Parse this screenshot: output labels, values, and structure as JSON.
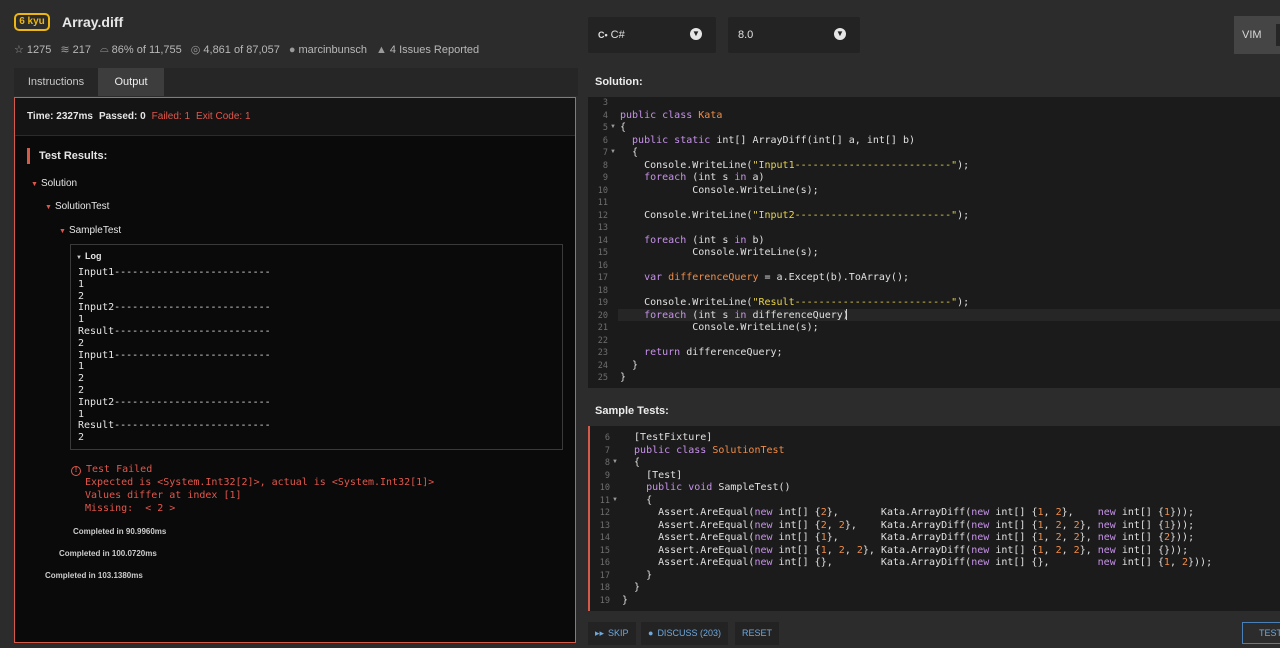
{
  "header": {
    "rank": "6 kyu",
    "title": "Array.diff",
    "stats": {
      "stars": "1275",
      "collections": "217",
      "satisfaction": "86% of 11,755",
      "completed": "4,861 of 87,057",
      "author": "marcinbunsch",
      "issues": "4 Issues Reported"
    }
  },
  "language": {
    "selected": "C#",
    "version": "8.0"
  },
  "vim_label": "VIM",
  "tabs": [
    {
      "label": "Instructions",
      "active": false
    },
    {
      "label": "Output",
      "active": true
    }
  ],
  "output": {
    "time": "Time: 2327ms",
    "passed": "Passed: 0",
    "failed": "Failed: 1",
    "exit_code": "Exit Code: 1",
    "results_header": "Test Results:",
    "tree": [
      "Solution",
      "SolutionTest",
      "SampleTest"
    ],
    "log_label": "Log",
    "log_lines": [
      "Input1--------------------------",
      "1",
      "2",
      "Input2--------------------------",
      "1",
      "Result--------------------------",
      "2",
      "Input1--------------------------",
      "1",
      "2",
      "2",
      "Input2--------------------------",
      "1",
      "Result--------------------------",
      "2"
    ],
    "fail_title": "Test Failed",
    "fail_lines": [
      "Expected is <System.Int32[2]>, actual is <System.Int32[1]>",
      "Values differ at index [1]",
      "Missing:  < 2 >"
    ],
    "completed": [
      "Completed in 90.9960ms",
      "Completed in 100.0720ms",
      "Completed in 103.1380ms"
    ]
  },
  "solution": {
    "header": "Solution:",
    "line_numbers": [
      "3",
      "4",
      "5",
      "6",
      "7",
      "8",
      "9",
      "10",
      "11",
      "12",
      "13",
      "14",
      "15",
      "16",
      "17",
      "18",
      "19",
      "20",
      "21",
      "22",
      "23",
      "24",
      "25"
    ],
    "lines": [
      [],
      [
        {
          "t": "public class ",
          "c": "kw"
        },
        {
          "t": "Kata",
          "c": "cls"
        }
      ],
      [
        {
          "t": "{",
          "c": ""
        }
      ],
      [
        {
          "t": "  public static ",
          "c": "kw"
        },
        {
          "t": "int[] ArrayDiff(int[] a, int[] b)",
          "c": ""
        }
      ],
      [
        {
          "t": "  {",
          "c": ""
        }
      ],
      [
        {
          "t": "    Console.WriteLine(",
          "c": ""
        },
        {
          "t": "\"Input1--------------------------\"",
          "c": "str"
        },
        {
          "t": ");",
          "c": ""
        }
      ],
      [
        {
          "t": "    foreach ",
          "c": "kw"
        },
        {
          "t": "(int s ",
          "c": ""
        },
        {
          "t": "in ",
          "c": "kw"
        },
        {
          "t": "a)",
          "c": ""
        }
      ],
      [
        {
          "t": "            Console.WriteLine(s);",
          "c": ""
        }
      ],
      [],
      [
        {
          "t": "    Console.WriteLine(",
          "c": ""
        },
        {
          "t": "\"Input2--------------------------\"",
          "c": "str"
        },
        {
          "t": ");",
          "c": ""
        }
      ],
      [],
      [
        {
          "t": "    foreach ",
          "c": "kw"
        },
        {
          "t": "(int s ",
          "c": ""
        },
        {
          "t": "in ",
          "c": "kw"
        },
        {
          "t": "b)",
          "c": ""
        }
      ],
      [
        {
          "t": "            Console.WriteLine(s);",
          "c": ""
        }
      ],
      [],
      [
        {
          "t": "    var ",
          "c": "kw"
        },
        {
          "t": "differenceQuery",
          "c": "var"
        },
        {
          "t": " = a.Except(b).ToArray();",
          "c": ""
        }
      ],
      [],
      [
        {
          "t": "    Console.WriteLine(",
          "c": ""
        },
        {
          "t": "\"Result--------------------------\"",
          "c": "str"
        },
        {
          "t": ");",
          "c": ""
        }
      ],
      [
        {
          "t": "    foreach ",
          "c": "kw"
        },
        {
          "t": "(int s ",
          "c": ""
        },
        {
          "t": "in ",
          "c": "kw"
        },
        {
          "t": "differenceQuery)",
          "c": ""
        }
      ],
      [
        {
          "t": "            Console.WriteLine(s);",
          "c": ""
        }
      ],
      [],
      [
        {
          "t": "    return ",
          "c": "kw"
        },
        {
          "t": "differenceQuery;",
          "c": ""
        }
      ],
      [
        {
          "t": "  }",
          "c": ""
        }
      ],
      [
        {
          "t": "}",
          "c": ""
        }
      ]
    ]
  },
  "sample_tests": {
    "header": "Sample Tests:",
    "line_numbers": [
      "6",
      "7",
      "8",
      "9",
      "10",
      "11",
      "12",
      "13",
      "14",
      "15",
      "16",
      "17",
      "18",
      "19"
    ],
    "lines": [
      [
        {
          "t": "  [TestFixture]",
          "c": ""
        }
      ],
      [
        {
          "t": "  public class ",
          "c": "kw"
        },
        {
          "t": "SolutionTest",
          "c": "cls"
        }
      ],
      [
        {
          "t": "  {",
          "c": ""
        }
      ],
      [
        {
          "t": "    [Test]",
          "c": ""
        }
      ],
      [
        {
          "t": "    public void ",
          "c": "kw"
        },
        {
          "t": "SampleTest()",
          "c": ""
        }
      ],
      [
        {
          "t": "    {",
          "c": ""
        }
      ],
      [
        {
          "t": "      Assert.AreEqual(",
          "c": ""
        },
        {
          "t": "new ",
          "c": "kw"
        },
        {
          "t": "int[] {",
          "c": ""
        },
        {
          "t": "2",
          "c": "num"
        },
        {
          "t": "},       Kata.ArrayDiff(",
          "c": ""
        },
        {
          "t": "new ",
          "c": "kw"
        },
        {
          "t": "int[] {",
          "c": ""
        },
        {
          "t": "1",
          "c": "num"
        },
        {
          "t": ", ",
          "c": ""
        },
        {
          "t": "2",
          "c": "num"
        },
        {
          "t": "},    ",
          "c": ""
        },
        {
          "t": "new ",
          "c": "kw"
        },
        {
          "t": "int[] {",
          "c": ""
        },
        {
          "t": "1",
          "c": "num"
        },
        {
          "t": "}));",
          "c": ""
        }
      ],
      [
        {
          "t": "      Assert.AreEqual(",
          "c": ""
        },
        {
          "t": "new ",
          "c": "kw"
        },
        {
          "t": "int[] {",
          "c": ""
        },
        {
          "t": "2",
          "c": "num"
        },
        {
          "t": ", ",
          "c": ""
        },
        {
          "t": "2",
          "c": "num"
        },
        {
          "t": "},    Kata.ArrayDiff(",
          "c": ""
        },
        {
          "t": "new ",
          "c": "kw"
        },
        {
          "t": "int[] {",
          "c": ""
        },
        {
          "t": "1",
          "c": "num"
        },
        {
          "t": ", ",
          "c": ""
        },
        {
          "t": "2",
          "c": "num"
        },
        {
          "t": ", ",
          "c": ""
        },
        {
          "t": "2",
          "c": "num"
        },
        {
          "t": "}, ",
          "c": ""
        },
        {
          "t": "new ",
          "c": "kw"
        },
        {
          "t": "int[] {",
          "c": ""
        },
        {
          "t": "1",
          "c": "num"
        },
        {
          "t": "}));",
          "c": ""
        }
      ],
      [
        {
          "t": "      Assert.AreEqual(",
          "c": ""
        },
        {
          "t": "new ",
          "c": "kw"
        },
        {
          "t": "int[] {",
          "c": ""
        },
        {
          "t": "1",
          "c": "num"
        },
        {
          "t": "},       Kata.ArrayDiff(",
          "c": ""
        },
        {
          "t": "new ",
          "c": "kw"
        },
        {
          "t": "int[] {",
          "c": ""
        },
        {
          "t": "1",
          "c": "num"
        },
        {
          "t": ", ",
          "c": ""
        },
        {
          "t": "2",
          "c": "num"
        },
        {
          "t": ", ",
          "c": ""
        },
        {
          "t": "2",
          "c": "num"
        },
        {
          "t": "}, ",
          "c": ""
        },
        {
          "t": "new ",
          "c": "kw"
        },
        {
          "t": "int[] {",
          "c": ""
        },
        {
          "t": "2",
          "c": "num"
        },
        {
          "t": "}));",
          "c": ""
        }
      ],
      [
        {
          "t": "      Assert.AreEqual(",
          "c": ""
        },
        {
          "t": "new ",
          "c": "kw"
        },
        {
          "t": "int[] {",
          "c": ""
        },
        {
          "t": "1",
          "c": "num"
        },
        {
          "t": ", ",
          "c": ""
        },
        {
          "t": "2",
          "c": "num"
        },
        {
          "t": ", ",
          "c": ""
        },
        {
          "t": "2",
          "c": "num"
        },
        {
          "t": "}, Kata.ArrayDiff(",
          "c": ""
        },
        {
          "t": "new ",
          "c": "kw"
        },
        {
          "t": "int[] {",
          "c": ""
        },
        {
          "t": "1",
          "c": "num"
        },
        {
          "t": ", ",
          "c": ""
        },
        {
          "t": "2",
          "c": "num"
        },
        {
          "t": ", ",
          "c": ""
        },
        {
          "t": "2",
          "c": "num"
        },
        {
          "t": "}, ",
          "c": ""
        },
        {
          "t": "new ",
          "c": "kw"
        },
        {
          "t": "int[] {}));",
          "c": ""
        }
      ],
      [
        {
          "t": "      Assert.AreEqual(",
          "c": ""
        },
        {
          "t": "new ",
          "c": "kw"
        },
        {
          "t": "int[] {},        Kata.ArrayDiff(",
          "c": ""
        },
        {
          "t": "new ",
          "c": "kw"
        },
        {
          "t": "int[] {},        ",
          "c": ""
        },
        {
          "t": "new ",
          "c": "kw"
        },
        {
          "t": "int[] {",
          "c": ""
        },
        {
          "t": "1",
          "c": "num"
        },
        {
          "t": ", ",
          "c": ""
        },
        {
          "t": "2",
          "c": "num"
        },
        {
          "t": "}));",
          "c": ""
        }
      ],
      [
        {
          "t": "    }",
          "c": ""
        }
      ],
      [
        {
          "t": "  }",
          "c": ""
        }
      ],
      [
        {
          "t": "}",
          "c": ""
        }
      ]
    ]
  },
  "bottom": {
    "skip": "SKIP",
    "discuss": "DISCUSS (203)",
    "reset": "RESET",
    "test": "TEST"
  }
}
